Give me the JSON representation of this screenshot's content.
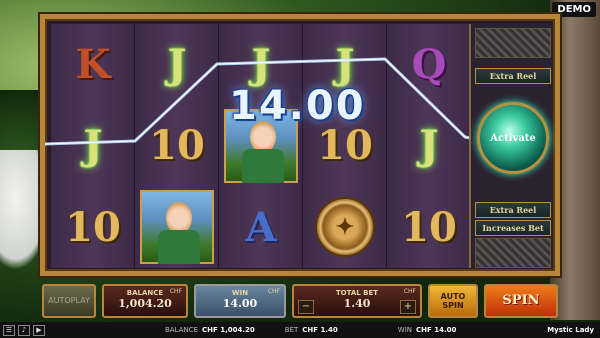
{
  "demo_badge": "DEMO",
  "reels": [
    [
      "K",
      "J",
      "J",
      "J",
      "Q"
    ],
    [
      "J",
      "10",
      "lady",
      "10",
      "J"
    ],
    [
      "10",
      "lady",
      "A",
      "coin",
      "10"
    ]
  ],
  "win_overlay": "14.00",
  "side_panel": {
    "extra_reel_top": "Extra Reel",
    "activate": "Activate",
    "extra_reel_bottom": "Extra Reel",
    "increases_bet": "Increases Bet"
  },
  "bottom": {
    "autoplay_label": "AUTOPLAY",
    "balance_caption": "BALANCE",
    "balance_value": "1,004.20",
    "currency": "CHF",
    "win_caption": "WIN",
    "win_value": "14.00",
    "total_bet_caption": "TOTAL BET",
    "total_bet_value": "1.40",
    "minus": "−",
    "plus": "+",
    "auto_spin_1": "AUTO",
    "auto_spin_2": "SPIN",
    "spin_label": "SPIN"
  },
  "status_bar": {
    "balance_label": "BALANCE",
    "balance_value": "CHF 1,004.20",
    "bet_label": "BET",
    "bet_value": "CHF 1.40",
    "win_label": "WIN",
    "win_value": "CHF 14.00",
    "game_name": "Mystic Lady"
  },
  "icons": [
    "menu-icon",
    "sound-icon",
    "play-icon"
  ]
}
